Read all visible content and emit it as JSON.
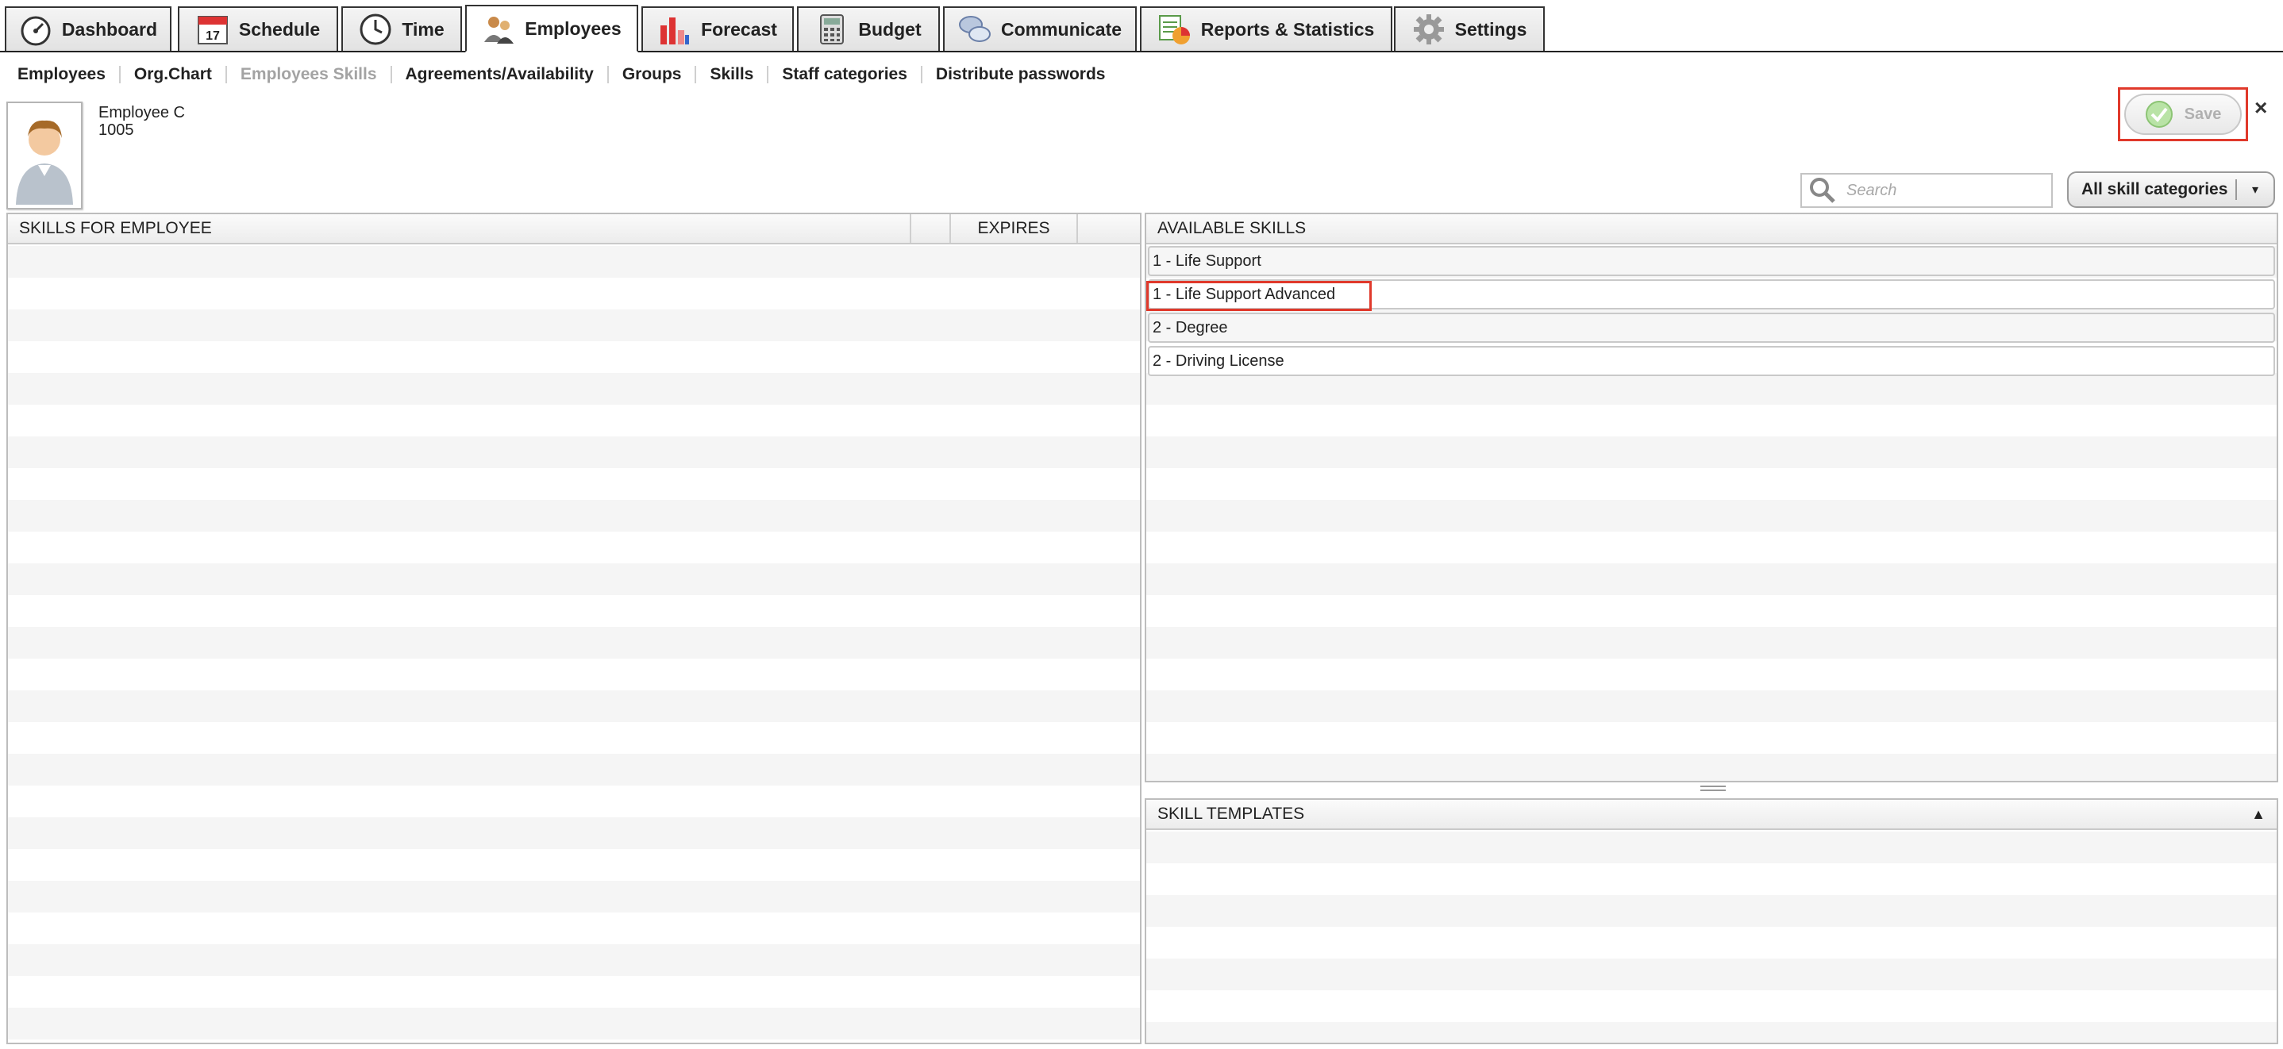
{
  "tabs": [
    {
      "label": "Dashboard",
      "icon": "speedometer-icon"
    },
    {
      "label": "Schedule",
      "icon": "calendar-icon",
      "calendar_day": "17"
    },
    {
      "label": "Time",
      "icon": "clock-icon"
    },
    {
      "label": "Employees",
      "icon": "employees-icon",
      "active": true
    },
    {
      "label": "Forecast",
      "icon": "bar-chart-icon"
    },
    {
      "label": "Budget",
      "icon": "calculator-icon"
    },
    {
      "label": "Communicate",
      "icon": "chat-icon"
    },
    {
      "label": "Reports & Statistics",
      "icon": "report-pie-icon"
    },
    {
      "label": "Settings",
      "icon": "gear-icon"
    }
  ],
  "subnav": [
    {
      "label": "Employees"
    },
    {
      "label": "Org.Chart"
    },
    {
      "label": "Employees Skills",
      "current": true
    },
    {
      "label": "Agreements/Availability"
    },
    {
      "label": "Groups"
    },
    {
      "label": "Skills"
    },
    {
      "label": "Staff categories"
    },
    {
      "label": "Distribute passwords"
    }
  ],
  "employee": {
    "name": "Employee C",
    "id": "1005",
    "avatar_icon": "person-avatar-icon"
  },
  "toolbar": {
    "save_label": "Save",
    "close_label": "×"
  },
  "search": {
    "placeholder": "Search",
    "value": ""
  },
  "category_filter": {
    "selected": "All skill categories",
    "arrow": "▾"
  },
  "skills_for_employee": {
    "header": "SKILLS FOR EMPLOYEE",
    "col_expires": "EXPIRES",
    "rows": []
  },
  "available_skills": {
    "header": "AVAILABLE SKILLS",
    "items": [
      "1 - Life Support",
      "1 - Life Support Advanced",
      "2 - Degree",
      "2 - Driving License"
    ]
  },
  "skill_templates": {
    "header": "SKILL TEMPLATES",
    "toggle": "▲"
  },
  "colors": {
    "highlight": "#e0392b",
    "save_check": "#6cc24a"
  }
}
